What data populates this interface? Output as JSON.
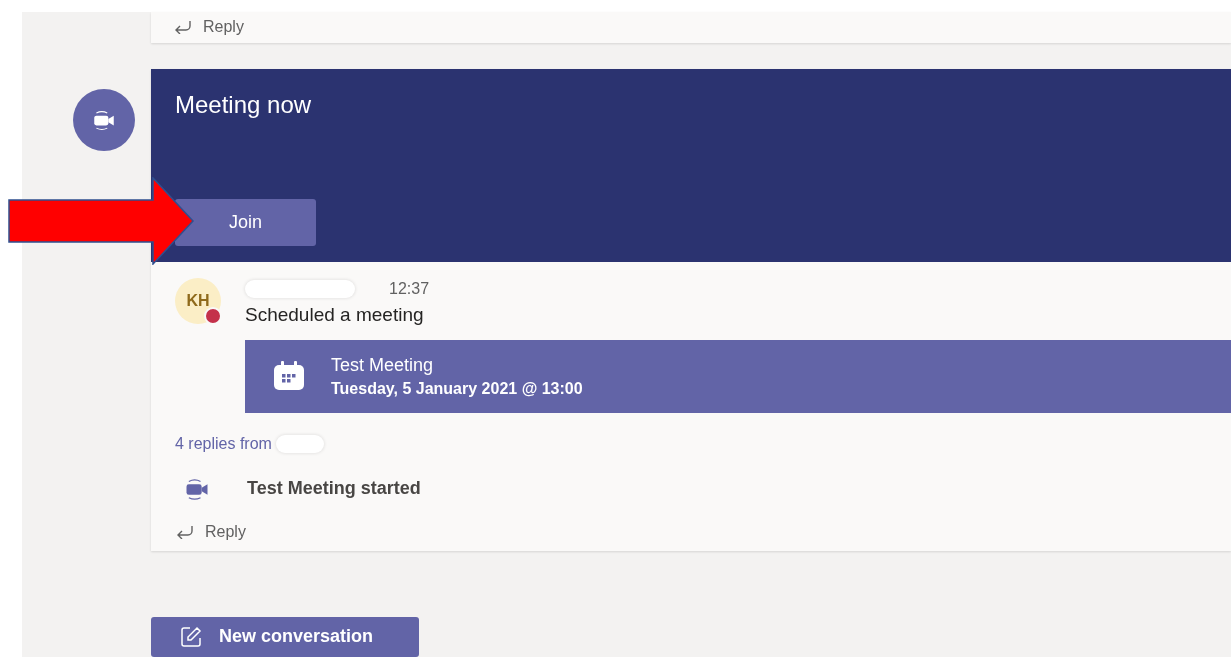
{
  "previous_post": {
    "reply_label": "Reply"
  },
  "meeting_post": {
    "header": {
      "title": "Meeting now",
      "join_button": "Join"
    },
    "message": {
      "avatar_initials": "KH",
      "time": "12:37",
      "text": "Scheduled a meeting",
      "meeting_card": {
        "title": "Test Meeting",
        "when": "Tuesday, 5 January 2021 @ 13:00"
      }
    },
    "replies_link": "4 replies from",
    "events": [
      {
        "text": "Test Meeting started"
      }
    ],
    "reply_label": "Reply"
  },
  "new_conversation_button": "New conversation"
}
